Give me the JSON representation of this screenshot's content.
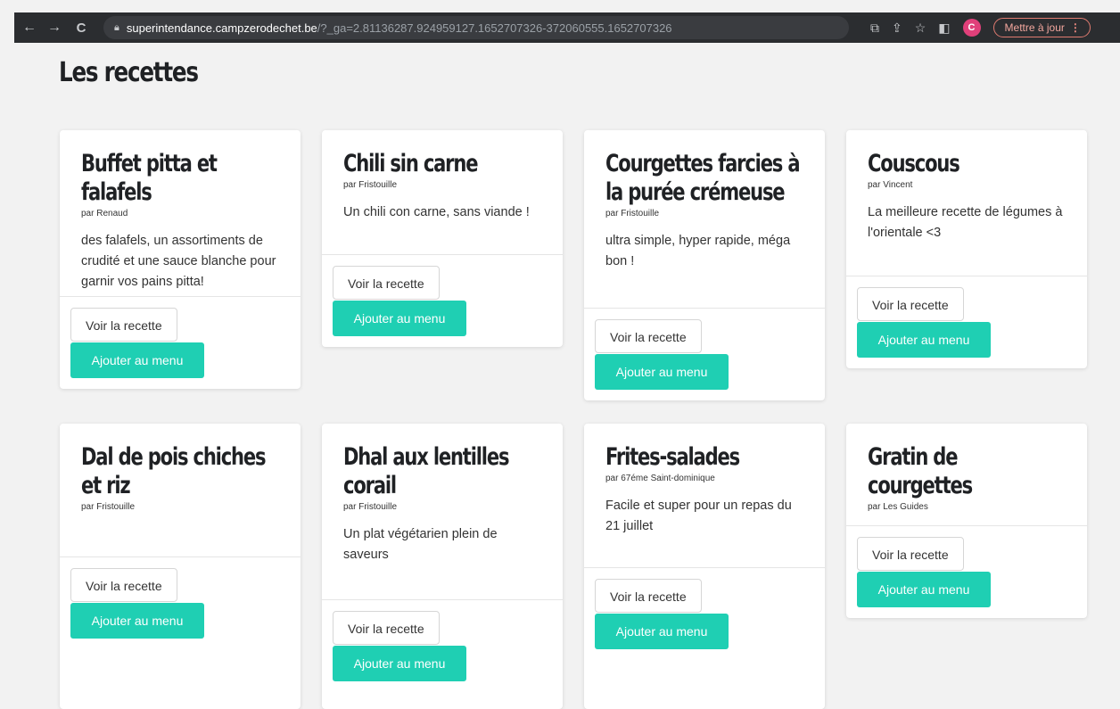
{
  "browser": {
    "url_host": "superintendance.campzerodechet.be",
    "url_rest": "/?_ga=2.81136287.924959127.1652707326-372060555.1652707326",
    "profile_initial": "C",
    "update_label": "Mettre à jour"
  },
  "page": {
    "title": "Les recettes"
  },
  "buttons": {
    "view": "Voir la recette",
    "add": "Ajouter au menu"
  },
  "recipes": [
    {
      "title": "Buffet pitta et falafels",
      "author": "par Renaud",
      "description": "des falafels, un assortiments de crudité et une sauce blanche pour garnir vos pains pitta!"
    },
    {
      "title": "Chili sin carne",
      "author": "par Fristouille",
      "description": "Un chili con carne, sans viande !"
    },
    {
      "title": "Courgettes farcies à la purée crémeuse",
      "author": "par Fristouille",
      "description": "ultra simple, hyper rapide, méga bon !"
    },
    {
      "title": "Couscous",
      "author": "par Vincent",
      "description": "La meilleure recette de légumes à l'orientale <3"
    },
    {
      "title": "Dal de pois chiches et riz",
      "author": "par Fristouille",
      "description": ""
    },
    {
      "title": "Dhal aux lentilles corail",
      "author": "par Fristouille",
      "description": "Un plat végétarien plein de saveurs"
    },
    {
      "title": "Frites-salades",
      "author": "par 67éme Saint-dominique",
      "description": "Facile et super pour un repas du 21 juillet"
    },
    {
      "title": "Gratin de courgettes",
      "author": "par Les Guides",
      "description": ""
    }
  ],
  "colors": {
    "accent": "#1fcfb3",
    "browser_bar": "#2b2d30"
  }
}
